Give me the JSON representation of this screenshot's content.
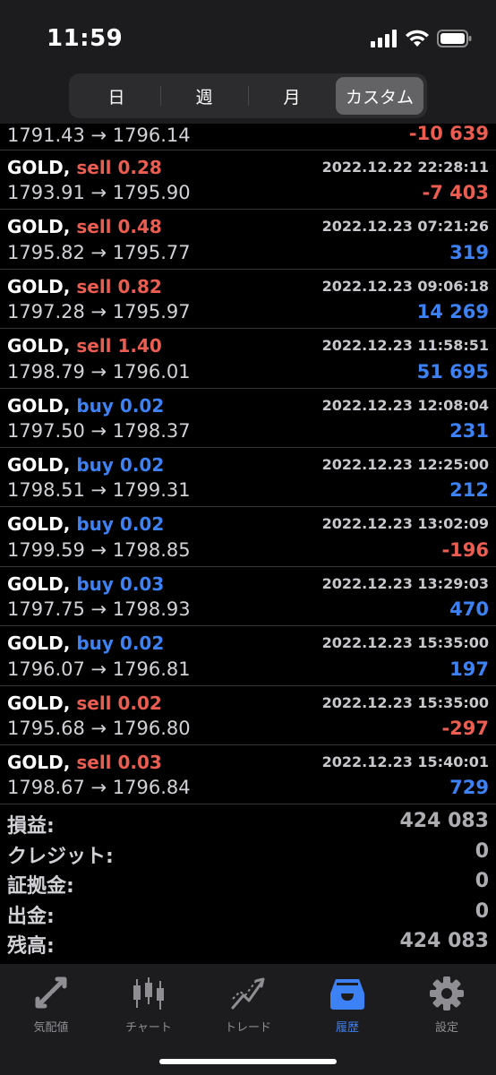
{
  "status_bar": {
    "time": "11:59"
  },
  "segments": [
    {
      "label": "日",
      "active": false
    },
    {
      "label": "週",
      "active": false
    },
    {
      "label": "月",
      "active": false
    },
    {
      "label": "カスタム",
      "active": true
    }
  ],
  "partial_row": {
    "prices": "1791.43 → 1796.14",
    "profit": "-10 639",
    "profit_sign": "neg"
  },
  "trades": [
    {
      "symbol": "GOLD,",
      "side": "sell",
      "volume": "0.28",
      "datetime": "2022.12.22 22:28:11",
      "prices": "1793.91 → 1795.90",
      "profit": "-7 403",
      "profit_sign": "neg"
    },
    {
      "symbol": "GOLD,",
      "side": "sell",
      "volume": "0.48",
      "datetime": "2022.12.23 07:21:26",
      "prices": "1795.82 → 1795.77",
      "profit": "319",
      "profit_sign": "pos"
    },
    {
      "symbol": "GOLD,",
      "side": "sell",
      "volume": "0.82",
      "datetime": "2022.12.23 09:06:18",
      "prices": "1797.28 → 1795.97",
      "profit": "14 269",
      "profit_sign": "pos"
    },
    {
      "symbol": "GOLD,",
      "side": "sell",
      "volume": "1.40",
      "datetime": "2022.12.23 11:58:51",
      "prices": "1798.79 → 1796.01",
      "profit": "51 695",
      "profit_sign": "pos"
    },
    {
      "symbol": "GOLD,",
      "side": "buy",
      "volume": "0.02",
      "datetime": "2022.12.23 12:08:04",
      "prices": "1797.50 → 1798.37",
      "profit": "231",
      "profit_sign": "pos"
    },
    {
      "symbol": "GOLD,",
      "side": "buy",
      "volume": "0.02",
      "datetime": "2022.12.23 12:25:00",
      "prices": "1798.51 → 1799.31",
      "profit": "212",
      "profit_sign": "pos"
    },
    {
      "symbol": "GOLD,",
      "side": "buy",
      "volume": "0.02",
      "datetime": "2022.12.23 13:02:09",
      "prices": "1799.59 → 1798.85",
      "profit": "-196",
      "profit_sign": "neg"
    },
    {
      "symbol": "GOLD,",
      "side": "buy",
      "volume": "0.03",
      "datetime": "2022.12.23 13:29:03",
      "prices": "1797.75 → 1798.93",
      "profit": "470",
      "profit_sign": "pos"
    },
    {
      "symbol": "GOLD,",
      "side": "buy",
      "volume": "0.02",
      "datetime": "2022.12.23 15:35:00",
      "prices": "1796.07 → 1796.81",
      "profit": "197",
      "profit_sign": "pos"
    },
    {
      "symbol": "GOLD,",
      "side": "sell",
      "volume": "0.02",
      "datetime": "2022.12.23 15:35:00",
      "prices": "1795.68 → 1796.80",
      "profit": "-297",
      "profit_sign": "neg"
    },
    {
      "symbol": "GOLD,",
      "side": "sell",
      "volume": "0.03",
      "datetime": "2022.12.23 15:40:01",
      "prices": "1798.67 → 1796.84",
      "profit": "729",
      "profit_sign": "pos"
    }
  ],
  "summary": [
    {
      "label": "損益:",
      "value": "424 083"
    },
    {
      "label": "クレジット:",
      "value": "0"
    },
    {
      "label": "証拠金:",
      "value": "0"
    },
    {
      "label": "出金:",
      "value": "0"
    },
    {
      "label": "残高:",
      "value": "424 083"
    }
  ],
  "tabs": [
    {
      "label": "気配値",
      "icon": "quotes-arrows-icon",
      "active": false
    },
    {
      "label": "チャート",
      "icon": "candlestick-chart-icon",
      "active": false
    },
    {
      "label": "トレード",
      "icon": "trade-line-icon",
      "active": false
    },
    {
      "label": "履歴",
      "icon": "history-inbox-icon",
      "active": true
    },
    {
      "label": "設定",
      "icon": "gear-icon",
      "active": false
    }
  ],
  "colors": {
    "sell": "#eb5d50",
    "buy": "#3d82f5",
    "loss": "#eb5d50",
    "profit": "#3d82f5",
    "active_tab": "#3d82f5"
  }
}
